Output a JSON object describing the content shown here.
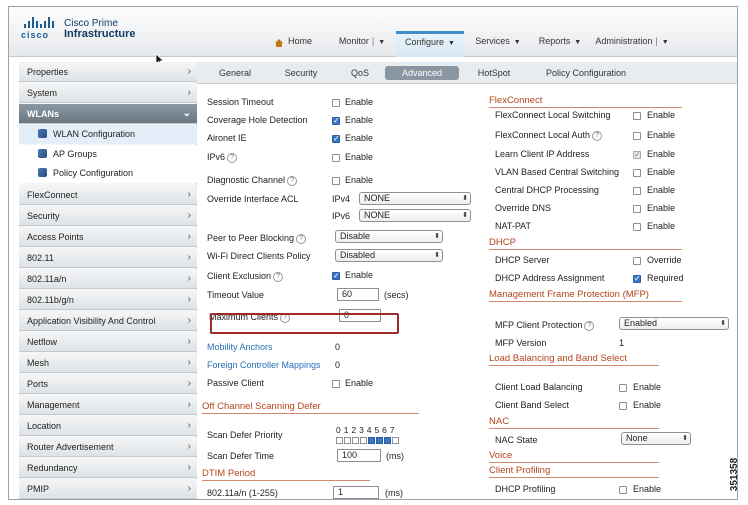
{
  "brand": {
    "logo_word": "cisco",
    "title_line1": "Cisco Prime",
    "title_line2": "Infrastructure"
  },
  "topnav": {
    "home": "Home",
    "monitor": "Monitor",
    "configure": "Configure",
    "services": "Services",
    "reports": "Reports",
    "administration": "Administration"
  },
  "sidebar": {
    "items_top": [
      "Properties",
      "System"
    ],
    "wlans": "WLANs",
    "sub": [
      "WLAN Configuration",
      "AP Groups",
      "Policy Configuration"
    ],
    "items": [
      "FlexConnect",
      "Security",
      "Access Points",
      "802.11",
      "802.11a/n",
      "802.11b/g/n",
      "Application Visibility And Control",
      "Netflow",
      "Mesh",
      "Ports",
      "Management",
      "Location",
      "Router Advertisement",
      "Redundancy",
      "PMIP"
    ]
  },
  "tabs": [
    "General",
    "Security",
    "QoS",
    "Advanced",
    "HotSpot",
    "Policy Configuration"
  ],
  "left": {
    "session_timeout": "Session Timeout",
    "coverage_hole": "Coverage Hole Detection",
    "aironet": "Aironet IE",
    "ipv6": "IPv6",
    "diag": "Diagnostic Channel",
    "override_acl": "Override Interface ACL",
    "ipv4_lbl": "IPv4",
    "ipv4_val": "NONE",
    "ipv6_lbl": "IPv6",
    "ipv6_val": "NONE",
    "p2p": "Peer to Peer Blocking",
    "p2p_val": "Disable",
    "wifi_direct": "Wi-Fi Direct Clients Policy",
    "wifi_direct_val": "Disabled",
    "client_excl": "Client Exclusion",
    "timeout_val_lbl": "Timeout Value",
    "timeout_val": "60",
    "secs": "(secs)",
    "max_clients": "Maximum Clients",
    "max_clients_val": "0",
    "mobility_anchors": "Mobility Anchors",
    "mobility_anchors_val": "0",
    "foreign_ctrl": "Foreign Controller Mappings",
    "foreign_ctrl_val": "0",
    "passive_client": "Passive Client",
    "enable": "Enable",
    "off_channel": "Off Channel Scanning Defer",
    "scan_priority": "Scan Defer Priority",
    "priority_digits": "0 1 2 3 4 5 6 7",
    "scan_time": "Scan Defer Time",
    "scan_time_val": "100",
    "ms": "(ms)",
    "dtim": "DTIM Period",
    "dtim_an": "802.11a/n (1-255)",
    "dtim_an_val": "1"
  },
  "right": {
    "flexconnect": "FlexConnect",
    "fc_local_switching": "FlexConnect Local Switching",
    "fc_local_auth": "FlexConnect Local Auth",
    "learn_ip": "Learn Client IP Address",
    "vlan_central": "VLAN Based Central Switching",
    "central_dhcp": "Central DHCP Processing",
    "override_dns": "Override DNS",
    "nat_pat": "NAT-PAT",
    "dhcp": "DHCP",
    "dhcp_server": "DHCP Server",
    "override": "Override",
    "dhcp_assign": "DHCP Address Assignment",
    "required": "Required",
    "mfp": "Management Frame Protection (MFP)",
    "mfp_client": "MFP Client Protection",
    "mfp_client_val": "Enabled",
    "mfp_version": "MFP Version",
    "mfp_version_val": "1",
    "load_bal": "Load Balancing and Band Select",
    "client_lb": "Client Load Balancing",
    "client_bs": "Client Band Select",
    "nac": "NAC",
    "nac_state": "NAC State",
    "nac_state_val": "None",
    "voice": "Voice",
    "client_profiling": "Client Profiling",
    "dhcp_profiling": "DHCP Profiling",
    "enable": "Enable"
  },
  "figure_id": "351358"
}
